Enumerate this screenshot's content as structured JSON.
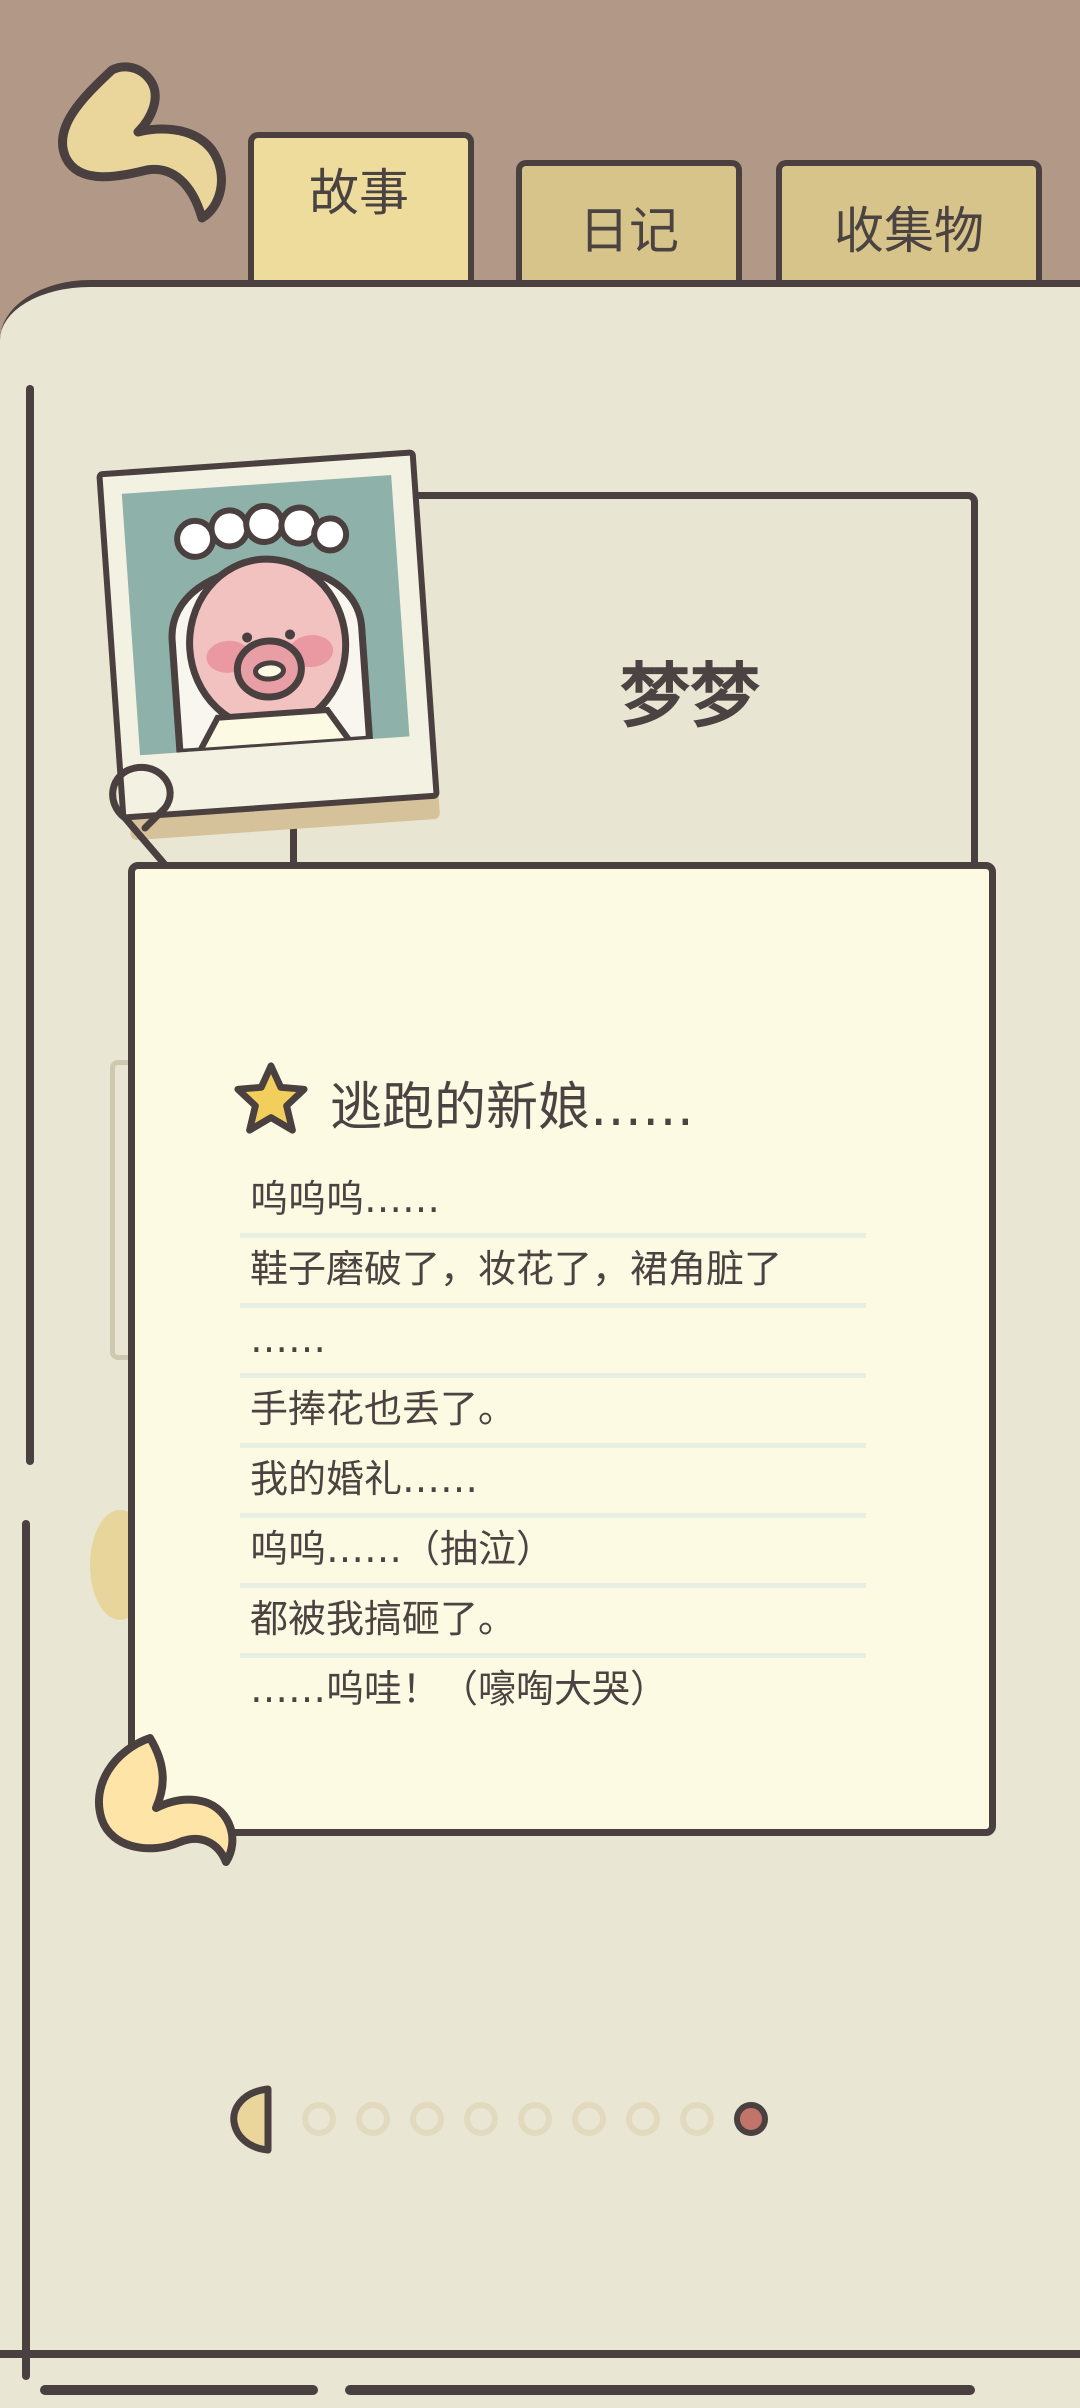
{
  "tabs": [
    {
      "label": "故事",
      "active": true
    },
    {
      "label": "日记",
      "active": false
    },
    {
      "label": "收集物",
      "active": false
    }
  ],
  "character": {
    "name": "梦梦"
  },
  "story": {
    "title": "逃跑的新娘……",
    "lines": [
      "呜呜呜……",
      "鞋子磨破了，妆花了，裙角脏了",
      "……",
      "手捧花也丢了。",
      "我的婚礼……",
      "呜呜……（抽泣）",
      "都被我搞砸了。",
      "……呜哇！（嚎啕大哭）"
    ]
  },
  "pager": {
    "total_pages": 9,
    "current_page": 9
  },
  "icons": {
    "back": "back-arrow-icon",
    "star": "star-icon",
    "prev": "prev-page-icon"
  },
  "colors": {
    "background": "#b29886",
    "book": "#e9e6d3",
    "note": "#fdfae4",
    "tab": "#e2cd8d",
    "outline": "#4a403f",
    "active_dot": "#c1756a"
  }
}
